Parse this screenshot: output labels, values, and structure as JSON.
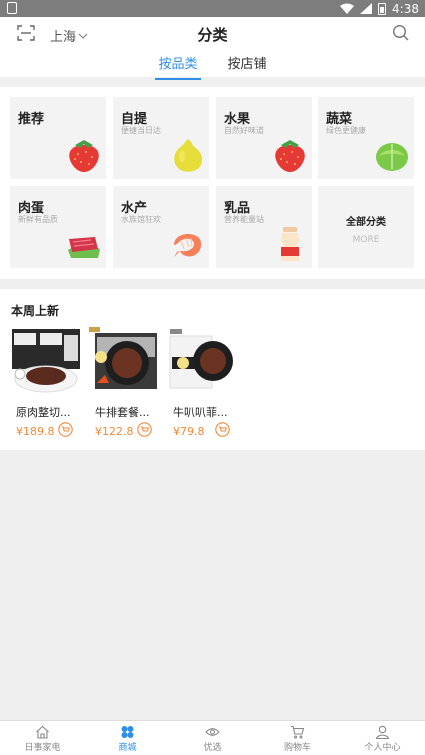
{
  "statusbar": {
    "time": "4:38"
  },
  "header": {
    "city": "上海",
    "title": "分类",
    "tabs": [
      {
        "label": "按品类",
        "active": true
      },
      {
        "label": "按店铺",
        "active": false
      }
    ]
  },
  "categories": [
    {
      "name": "推荐",
      "sub": "",
      "icon": "strawberry-icon"
    },
    {
      "name": "自提",
      "sub": "便捷当日达",
      "icon": "pomelo-icon"
    },
    {
      "name": "水果",
      "sub": "自然好味道",
      "icon": "strawberry-icon"
    },
    {
      "name": "蔬菜",
      "sub": "绿色更健康",
      "icon": "lettuce-icon"
    },
    {
      "name": "肉蛋",
      "sub": "新鲜有品质",
      "icon": "meat-icon"
    },
    {
      "name": "水产",
      "sub": "水族馆狂欢",
      "icon": "shrimp-icon"
    },
    {
      "name": "乳品",
      "sub": "营养能量站",
      "icon": "yogurt-drink-icon"
    }
  ],
  "all_categories": {
    "label": "全部分类",
    "more": "MORE"
  },
  "new_this_week": {
    "title": "本周上新",
    "products": [
      {
        "name": "原肉整切...",
        "price": "¥189.8"
      },
      {
        "name": "牛排套餐...",
        "price": "¥122.8"
      },
      {
        "name": "牛叭叭菲...",
        "price": "¥79.8"
      }
    ]
  },
  "bottom_nav": [
    {
      "label": "日事家电",
      "icon": "home-icon",
      "active": false
    },
    {
      "label": "商城",
      "icon": "mall-icon",
      "active": true
    },
    {
      "label": "优选",
      "icon": "eye-icon",
      "active": false
    },
    {
      "label": "购物车",
      "icon": "cart-icon",
      "active": false
    },
    {
      "label": "个人中心",
      "icon": "user-icon",
      "active": false
    }
  ],
  "colors": {
    "accent": "#2e8ee8",
    "price": "#f08a3a"
  }
}
